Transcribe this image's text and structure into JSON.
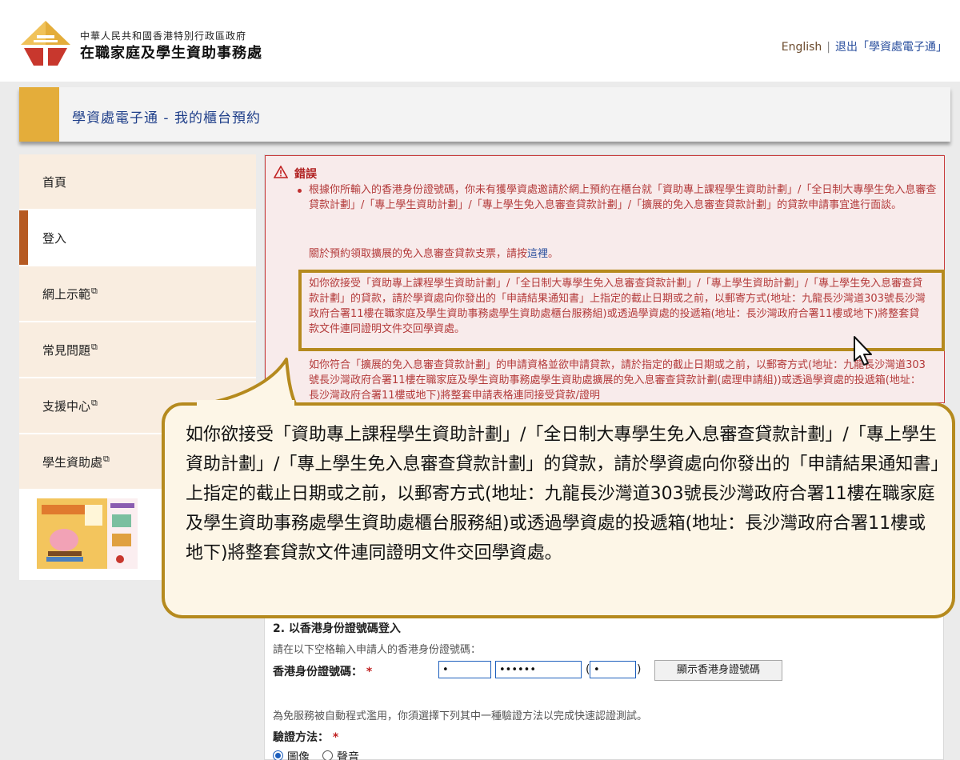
{
  "header": {
    "gov_name": "中華人民共和國香港特別行政區政府",
    "dept_name": "在職家庭及學生資助事務處",
    "lang_link": "English",
    "separator": "|",
    "logout_link": "退出「學資處電子通」",
    "logo_icon": "wfsfaa-logo-icon",
    "accent_color": "#e4ad3a"
  },
  "title_bar": {
    "title": "學資處電子通 - 我的櫃台預約"
  },
  "sidebar": {
    "items": [
      {
        "label": "首頁"
      },
      {
        "label": "登入"
      },
      {
        "label": "網上示範",
        "external": "⧉"
      },
      {
        "label": "常見問題",
        "external": "⧉"
      },
      {
        "label": "支援中心",
        "external": "⧉"
      },
      {
        "label": "學生資助處",
        "external": "⧉"
      }
    ],
    "active_index": 1,
    "active_color": "#b65a22"
  },
  "error": {
    "title": "錯誤",
    "icon": "warning-triangle-icon",
    "p1": "根據你所輸入的香港身份證號碼，你未有獲學資處邀請於網上預約在櫃台就「資助專上課程學生資助計劃」/「全日制大專學生免入息審查貸款計劃」/「專上學生資助計劃」/「專上學生免入息審查貸款計劃」/「擴展的免入息審查貸款計劃」的貸款申請事宜進行面談。",
    "p2_text": "關於預約領取擴展的免入息審查貸款支票，請按",
    "p2_link": "這裡",
    "p2_end": "。",
    "p3": "如你欲接受「資助專上課程學生資助計劃」/「全日制大專學生免入息審查貸款計劃」/「專上學生資助計劃」/「專上學生免入息審查貸款計劃」的貸款，請於學資處向你發出的「申請結果通知書」上指定的截止日期或之前，以郵寄方式(地址：九龍長沙灣道303號長沙灣政府合署11樓在職家庭及學生資助事務處學生資助處櫃台服務組)或透過學資處的投遞箱(地址：長沙灣政府合署11樓或地下)將整套貸款文件連同證明文件交回學資處。",
    "p4": "如你符合「擴展的免入息審查貸款計劃」的申請資格並欲申請貸款，請於指定的截止日期或之前，以郵寄方式(地址：九龍長沙灣道303號長沙灣政府合署11樓在職家庭及學生資助事務處學生資助處擴展的免入息審查貸款計劃(處理申請組))或透過學資處的投遞箱(地址：長沙灣政府合署11樓或地下)將整套申請表格連同接受貸款/證明",
    "text_color": "#b33a3a"
  },
  "callout": {
    "text": "如你欲接受「資助專上課程學生資助計劃」/「全日制大專學生免入息審查貸款計劃」/「專上學生資助計劃」/「專上學生免入息審查貸款計劃」的貸款，請於學資處向你發出的「申請結果通知書」上指定的截止日期或之前，以郵寄方式(地址：九龍長沙灣道303號長沙灣政府合署11樓在職家庭及學生資助事務處學生資助處櫃台服務組)或透過學資處的投遞箱(地址：長沙灣政府合署11樓或地下)將整套貸款文件連同證明文件交回學資處。",
    "border_color": "#b58a1e"
  },
  "form": {
    "section_title": "2. 以香港身份證號碼登入",
    "hint": "請在以下空格輸入申請人的香港身份證號碼：",
    "id_label": "香港身份證號碼：",
    "required_mark": "*",
    "id_part1": "•",
    "id_part2": "••••••",
    "paren_open": "(",
    "id_check": "•",
    "paren_close": ")",
    "show_id_button": "顯示香港身證號碼",
    "captcha_note": "為免服務被自動程式濫用，你須選擇下列其中一種驗證方法以完成快速認證測試。",
    "verify_label": "驗證方法：",
    "verify_options": [
      "圖像",
      "聲音"
    ],
    "verify_selected": "圖像"
  }
}
